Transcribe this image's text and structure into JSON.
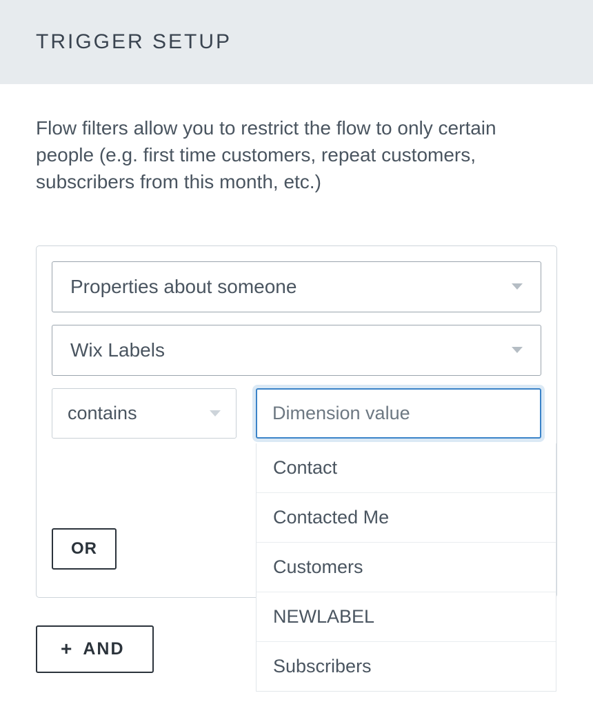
{
  "header": {
    "title": "TRIGGER SETUP"
  },
  "description": "Flow filters allow you to restrict the flow to only certain people (e.g. first time customers, repeat customers, subscribers from this month, etc.)",
  "filter": {
    "type_label": "Properties about someone",
    "property_label": "Wix Labels",
    "operator_label": "contains",
    "value_placeholder": "Dimension value",
    "options": [
      "Contact",
      "Contacted Me",
      "Customers",
      "NEWLABEL",
      "Subscribers"
    ]
  },
  "buttons": {
    "or": "OR",
    "and": "AND",
    "plus": "+"
  }
}
